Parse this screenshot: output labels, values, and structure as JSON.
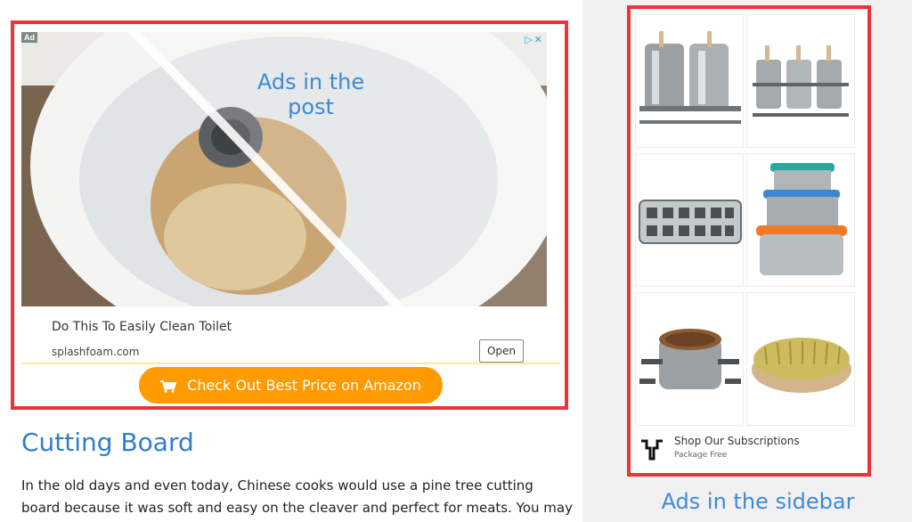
{
  "post_ad": {
    "badge": "Ad",
    "adchoices": "▷✕",
    "overlay_label": "Ads in the post",
    "headline": "Do This To Easily Clean Toilet",
    "domain": "splashfoam.com",
    "open_label": "Open"
  },
  "cta": {
    "label": "Check Out Best Price on Amazon",
    "icon": "shopping-cart-icon",
    "color": "#ff9b00"
  },
  "article": {
    "heading": "Cutting Board",
    "paragraph": "In the old days and even today, Chinese cooks would use a pine tree cutting board because it was soft and easy on the cleaver and perfect for meats. You may be able"
  },
  "sidebar_ad": {
    "adchoices": "▷✕",
    "products": [
      {
        "name": "popsicle-molds-icon"
      },
      {
        "name": "popsicle-rack-icon"
      },
      {
        "name": "ice-tray-icon"
      },
      {
        "name": "stacked-containers-icon"
      },
      {
        "name": "clamp-container-icon"
      },
      {
        "name": "scrub-brush-icon"
      }
    ],
    "shop_title": "Shop Our Subscriptions",
    "shop_sub": "Package Free",
    "caption": "Ads in the sidebar"
  },
  "colors": {
    "highlight_border": "#e8343a",
    "link_blue": "#2f7dcc",
    "label_blue": "#3d8ad8"
  }
}
